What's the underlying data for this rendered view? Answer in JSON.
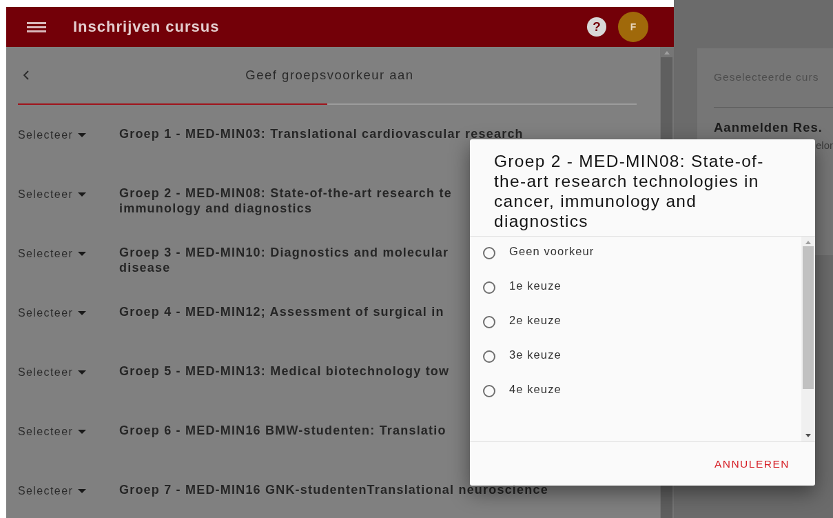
{
  "header": {
    "title": "Inschrijven cursus",
    "help_label": "?",
    "avatar_initial": "F"
  },
  "page": {
    "title": "Geef groepsvoorkeur aan",
    "progress": {
      "level": 0.5
    }
  },
  "groups": [
    {
      "select_label": "Selecteer",
      "lines": [
        "Groep 1 - MED-MIN03: Translational cardiovascular research"
      ]
    },
    {
      "select_label": "Selecteer",
      "lines": [
        "Groep 2 - MED-MIN08: State-of-the-art research te",
        "immunology and diagnostics"
      ]
    },
    {
      "select_label": "Selecteer",
      "lines": [
        "Groep 3 - MED-MIN10: Diagnostics and molecular",
        "disease"
      ]
    },
    {
      "select_label": "Selecteer",
      "lines": [
        "Groep 4 - MED-MIN12; Assessment of surgical in"
      ]
    },
    {
      "select_label": "Selecteer",
      "lines": [
        "Groep 5 - MED-MIN13: Medical biotechnology tow"
      ]
    },
    {
      "select_label": "Selecteer",
      "lines": [
        "Groep 6 - MED-MIN16 BMW-studenten: Translatio"
      ]
    },
    {
      "select_label": "Selecteer",
      "lines": [
        "Groep 7 - MED-MIN16 GNK-studentenTranslational neuroscience"
      ]
    }
  ],
  "side_card": {
    "heading": "Geselecteerde curs",
    "course": "Aanmelden Res.",
    "course_line_2": "elor"
  },
  "dialog": {
    "title": "Groep 2 - MED-MIN08: State-of-the-art research technologies in cancer, immunology and diagnostics",
    "options": [
      {
        "label": "Geen voorkeur",
        "selected": false
      },
      {
        "label": "1e keuze",
        "selected": false
      },
      {
        "label": "2e keuze",
        "selected": false
      },
      {
        "label": "3e keuze",
        "selected": false
      },
      {
        "label": "4e keuze",
        "selected": false
      }
    ],
    "cancel": "ANNULEREN"
  }
}
